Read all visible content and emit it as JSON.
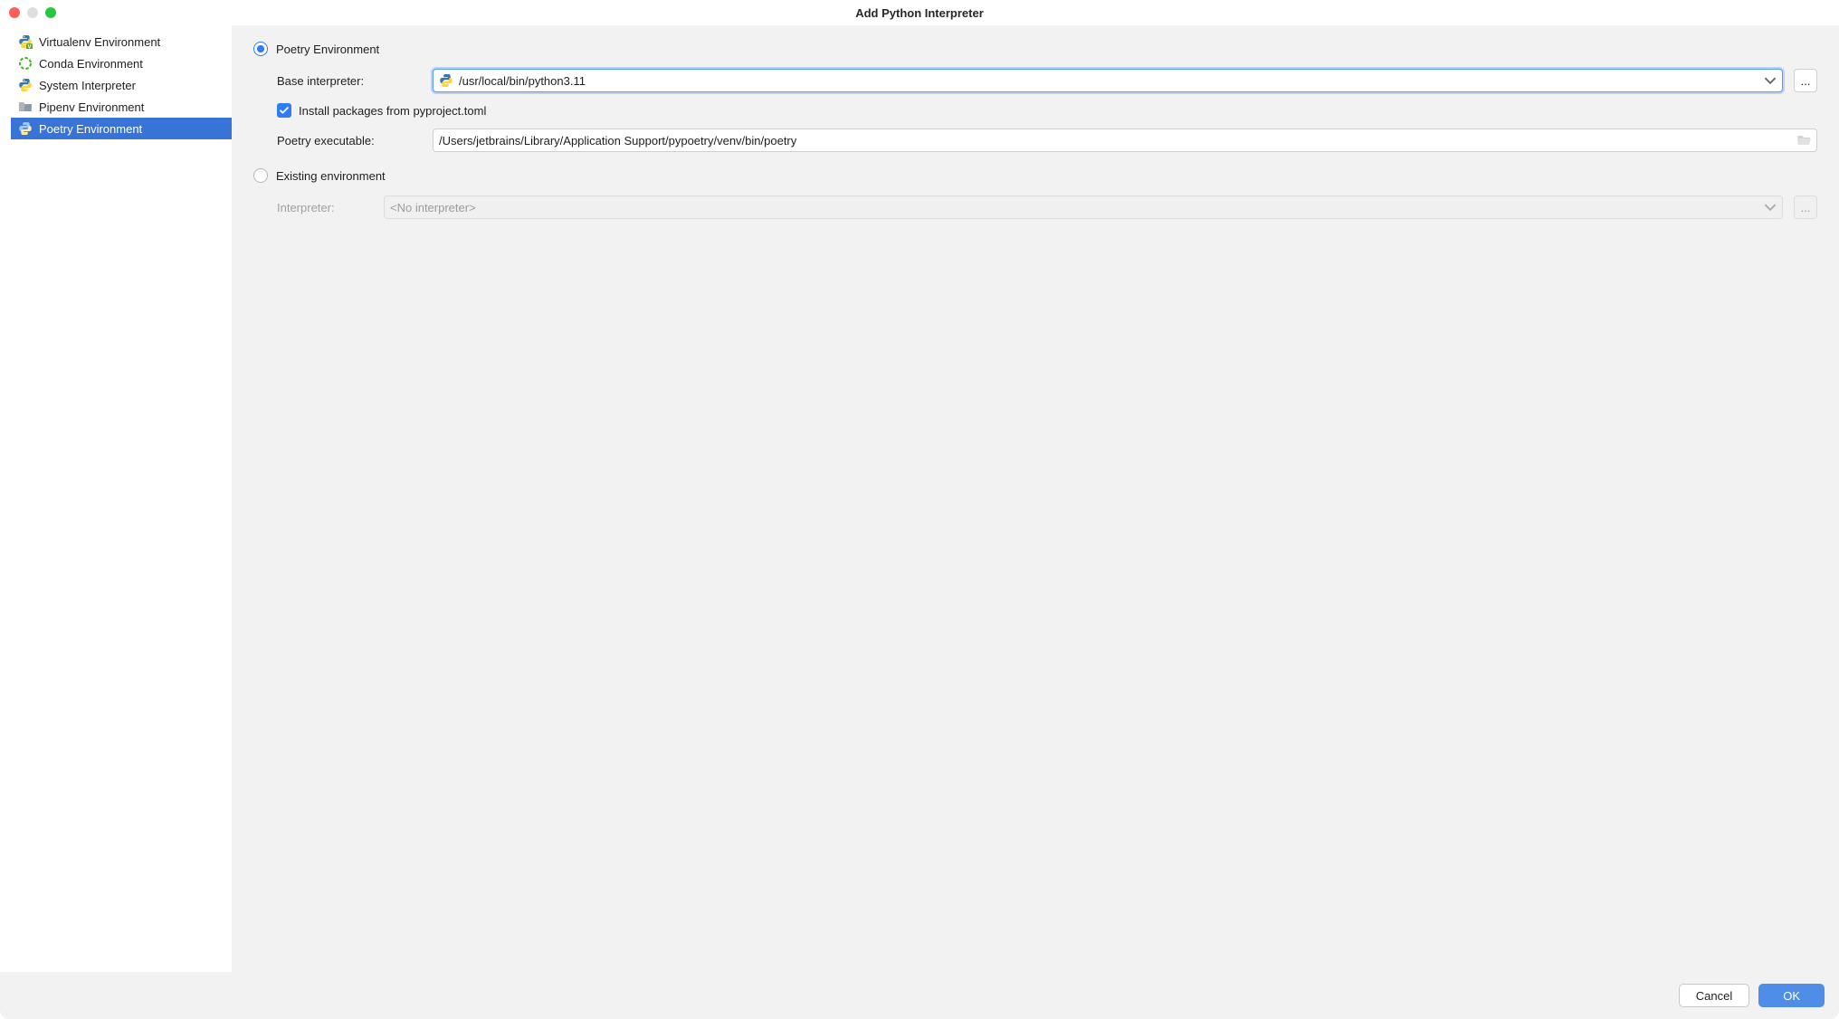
{
  "window": {
    "title": "Add Python Interpreter"
  },
  "sidebar": {
    "items": [
      {
        "label": "Virtualenv Environment"
      },
      {
        "label": "Conda Environment"
      },
      {
        "label": "System Interpreter"
      },
      {
        "label": "Pipenv Environment"
      },
      {
        "label": "Poetry Environment"
      }
    ]
  },
  "form": {
    "new_env": {
      "radio_label": "Poetry Environment",
      "base_interpreter_label": "Base interpreter:",
      "base_interpreter_value": "/usr/local/bin/python3.11",
      "install_packages_label": "Install packages from pyproject.toml",
      "poetry_exec_label": "Poetry executable:",
      "poetry_exec_value": "/Users/jetbrains/Library/Application Support/pypoetry/venv/bin/poetry"
    },
    "existing_env": {
      "radio_label": "Existing environment",
      "interpreter_label": "Interpreter:",
      "interpreter_placeholder": "<No interpreter>"
    }
  },
  "buttons": {
    "browse": "...",
    "cancel": "Cancel",
    "ok": "OK"
  }
}
